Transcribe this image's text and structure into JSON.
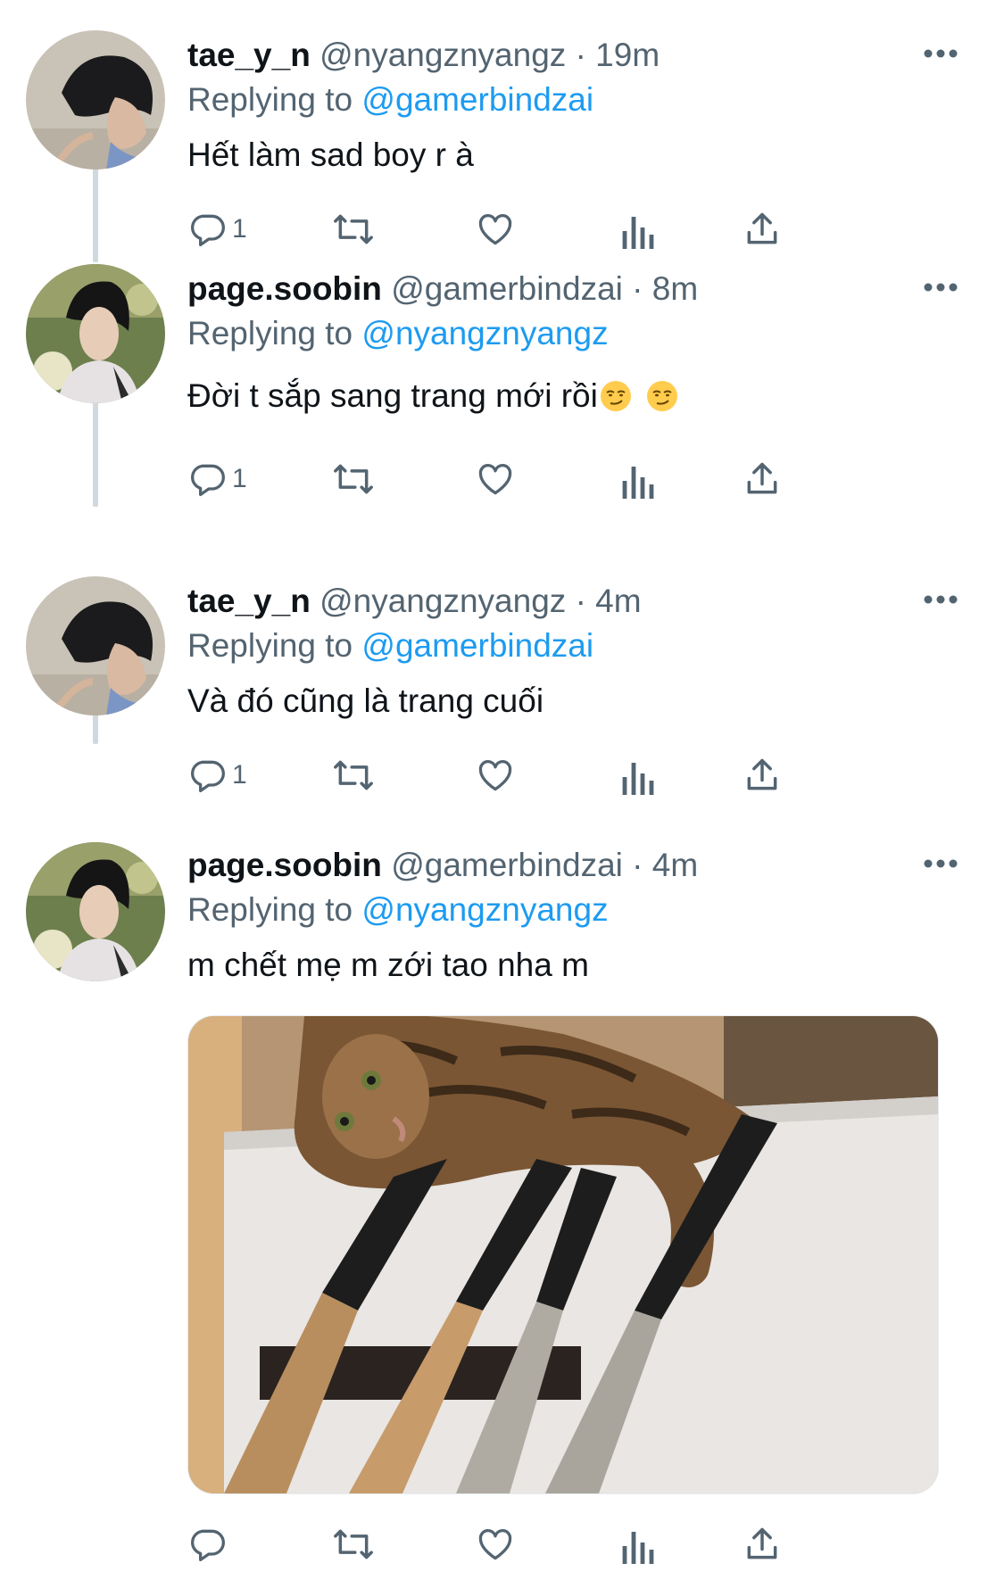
{
  "tweets": [
    {
      "name": "tae_y_n",
      "handle": "@nyangznyangz",
      "separator": "·",
      "time": "19m",
      "replying_prefix": "Replying to",
      "replying_to": "@gamerbindzai",
      "text": "Hết làm sad boy r à",
      "emoji_icons": [],
      "reply_count": "1",
      "avatar": "avatar-tae",
      "has_media": false
    },
    {
      "name": "page.soobin",
      "handle": "@gamerbindzai",
      "separator": "·",
      "time": "8m",
      "replying_prefix": "Replying to",
      "replying_to": "@nyangznyangz",
      "text": "Đời t sắp sang trang mới rồi",
      "emoji_icons": [
        "smirking-face-emoji",
        "smirking-face-emoji"
      ],
      "reply_count": "1",
      "avatar": "avatar-soobin",
      "has_media": false
    },
    {
      "name": "tae_y_n",
      "handle": "@nyangznyangz",
      "separator": "·",
      "time": "4m",
      "replying_prefix": "Replying to",
      "replying_to": "@gamerbindzai",
      "text": "Và đó cũng là trang cuối",
      "emoji_icons": [],
      "reply_count": "1",
      "avatar": "avatar-tae",
      "has_media": false
    },
    {
      "name": "page.soobin",
      "handle": "@gamerbindzai",
      "separator": "·",
      "time": "4m",
      "replying_prefix": "Replying to",
      "replying_to": "@nyangznyangz",
      "text": "m chết mẹ m zới tao nha m",
      "emoji_icons": [],
      "reply_count": "",
      "avatar": "avatar-soobin",
      "has_media": true,
      "media": "photo of tabby cat lying over knife block"
    }
  ],
  "icons": {
    "more": "more-dots-icon",
    "reply": "reply-icon",
    "retweet": "retweet-icon",
    "like": "like-heart-icon",
    "analytics": "analytics-bars-icon",
    "share": "share-upload-icon"
  },
  "colors": {
    "text": "#0f1419",
    "secondary": "#536471",
    "link": "#1d9bf0",
    "thread_line": "#cfd9de"
  }
}
